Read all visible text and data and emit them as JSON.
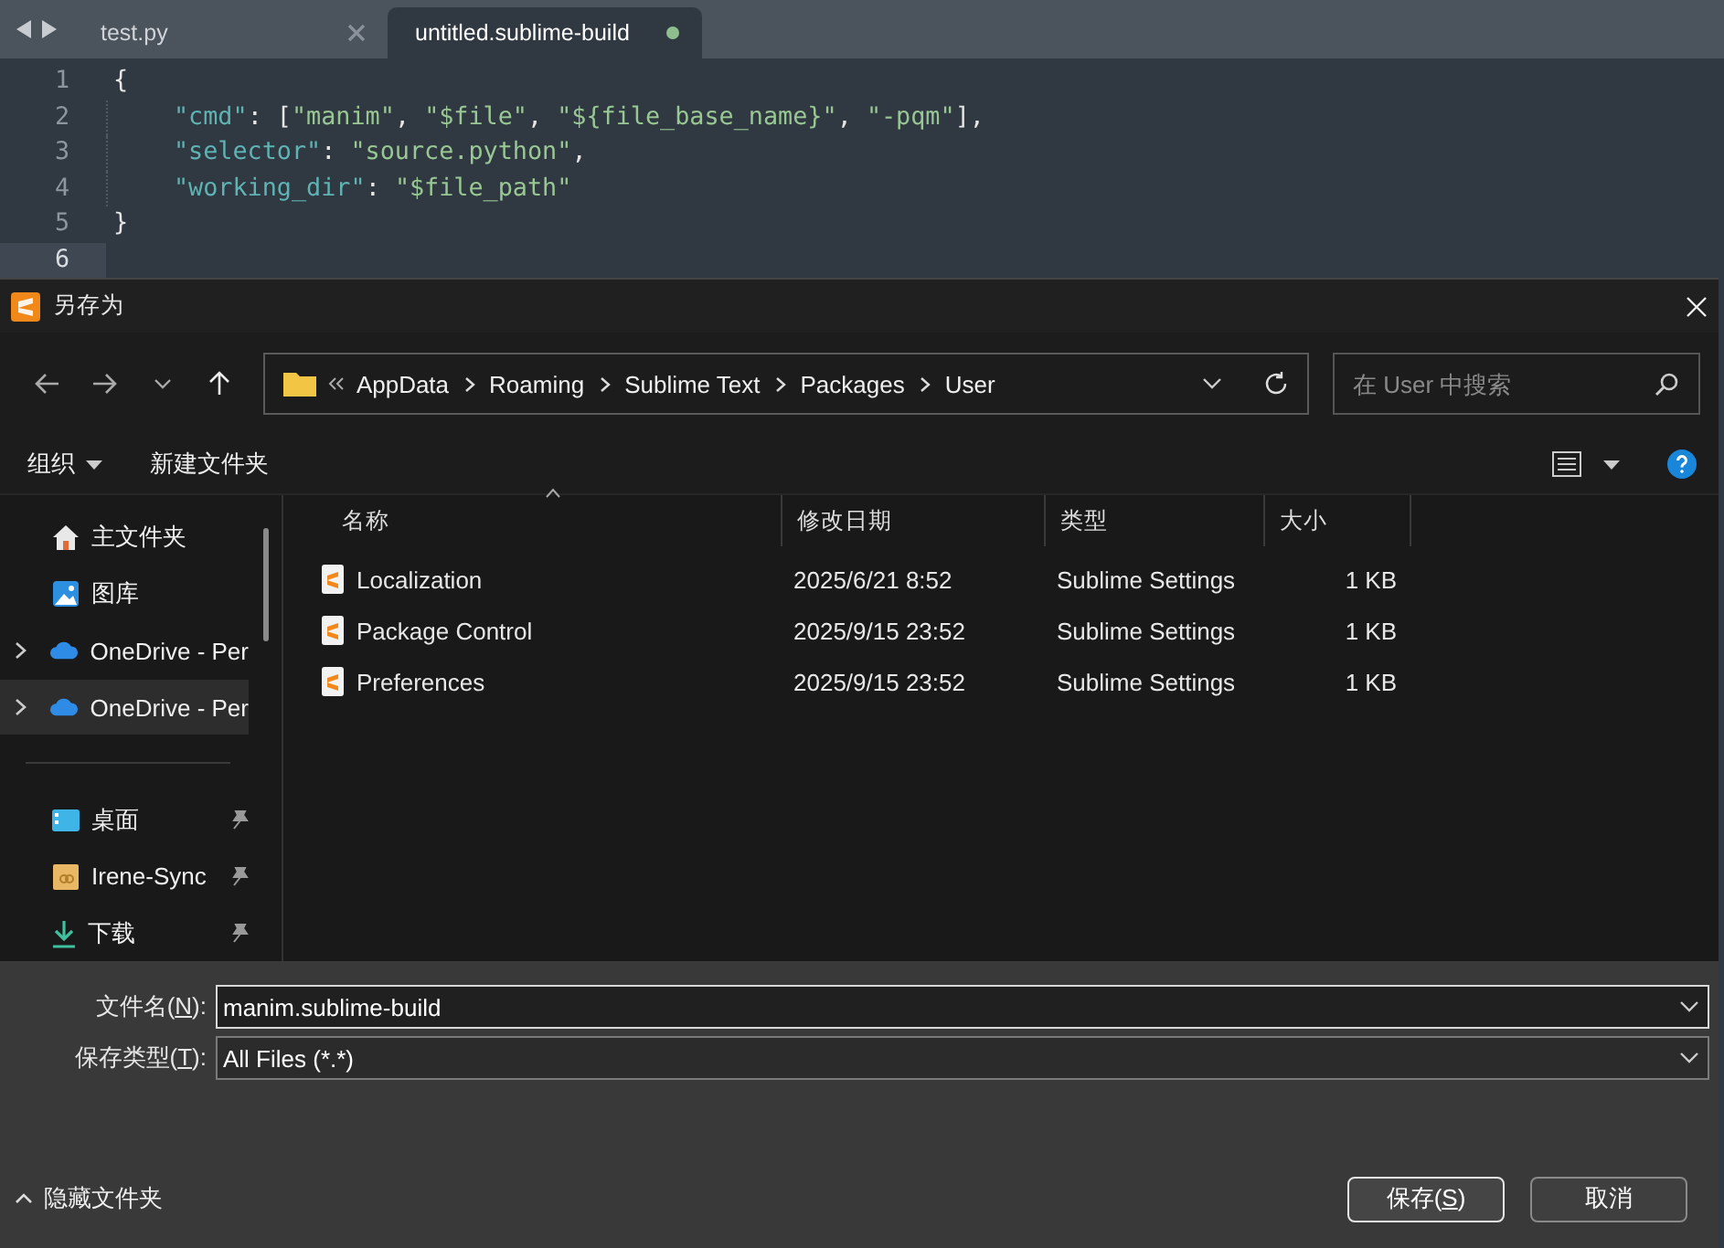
{
  "editor": {
    "tabs": [
      {
        "label": "test.py",
        "selected": false,
        "modified": false
      },
      {
        "label": "untitled.sublime-build",
        "selected": true,
        "modified": true
      }
    ],
    "lines": [
      {
        "number": "1",
        "indented": false,
        "current": false,
        "tokens": [
          {
            "kind": "punct",
            "text": "{"
          }
        ]
      },
      {
        "number": "2",
        "indented": true,
        "current": false,
        "tokens": [
          {
            "kind": "key",
            "text": "\"cmd\""
          },
          {
            "kind": "punct",
            "text": ": ["
          },
          {
            "kind": "string",
            "text": "\"manim\""
          },
          {
            "kind": "punct",
            "text": ", "
          },
          {
            "kind": "string",
            "text": "\"$file\""
          },
          {
            "kind": "punct",
            "text": ", "
          },
          {
            "kind": "string",
            "text": "\"${file_base_name}\""
          },
          {
            "kind": "punct",
            "text": ", "
          },
          {
            "kind": "string",
            "text": "\"-pqm\""
          },
          {
            "kind": "punct",
            "text": "],"
          }
        ]
      },
      {
        "number": "3",
        "indented": true,
        "current": false,
        "tokens": [
          {
            "kind": "key",
            "text": "\"selector\""
          },
          {
            "kind": "punct",
            "text": ": "
          },
          {
            "kind": "string",
            "text": "\"source.python\""
          },
          {
            "kind": "punct",
            "text": ","
          }
        ]
      },
      {
        "number": "4",
        "indented": true,
        "current": false,
        "tokens": [
          {
            "kind": "key",
            "text": "\"working_dir\""
          },
          {
            "kind": "punct",
            "text": ": "
          },
          {
            "kind": "string",
            "text": "\"$file_path\""
          }
        ]
      },
      {
        "number": "5",
        "indented": false,
        "current": false,
        "tokens": [
          {
            "kind": "punct",
            "text": "}"
          }
        ]
      },
      {
        "number": "6",
        "indented": false,
        "current": true
      }
    ]
  },
  "dialog": {
    "title": "另存为",
    "path": [
      "AppData",
      "Roaming",
      "Sublime Text",
      "Packages",
      "User"
    ],
    "search": {
      "placeholder": "在 User 中搜索"
    },
    "toolbar": {
      "organize": "组织",
      "new_folder": "新建文件夹"
    },
    "sidebar": {
      "items": [
        {
          "kind": "home",
          "label": "主文件夹",
          "expandable": false,
          "selected": false,
          "pinned": false
        },
        {
          "kind": "gallery",
          "label": "图库",
          "expandable": false,
          "selected": false,
          "pinned": false
        },
        {
          "kind": "cloud",
          "label": "OneDrive - Per",
          "expandable": true,
          "selected": false,
          "pinned": false
        },
        {
          "kind": "cloud",
          "label": "OneDrive - Per",
          "expandable": true,
          "selected": true,
          "pinned": false
        },
        {
          "kind": "divider"
        },
        {
          "kind": "desktop",
          "label": "桌面",
          "expandable": false,
          "selected": false,
          "pinned": true
        },
        {
          "kind": "folder",
          "label": "Irene-Sync",
          "expandable": false,
          "selected": false,
          "pinned": true
        },
        {
          "kind": "download",
          "label": "下载",
          "expandable": false,
          "selected": false,
          "pinned": true
        }
      ]
    },
    "columns": [
      {
        "label": "名称",
        "sorted": true
      },
      {
        "label": "修改日期",
        "sorted": false
      },
      {
        "label": "类型",
        "sorted": false
      },
      {
        "label": "大小",
        "sorted": false
      }
    ],
    "files": [
      {
        "name": "Localization",
        "modified": "2025/6/21 8:52",
        "type": "Sublime Settings",
        "size": "1 KB"
      },
      {
        "name": "Package Control",
        "modified": "2025/9/15 23:52",
        "type": "Sublime Settings",
        "size": "1 KB"
      },
      {
        "name": "Preferences",
        "modified": "2025/9/15 23:52",
        "type": "Sublime Settings",
        "size": "1 KB"
      }
    ],
    "filename": {
      "label": "文件名(",
      "access_key": "N",
      "label_end": "):",
      "value": "manim.sublime-build",
      "focused": true
    },
    "filetype": {
      "label": "保存类型(",
      "access_key": "T",
      "label_end": "):",
      "value": "All Files (*.*)",
      "focused": false
    },
    "hide_folders": "隐藏文件夹",
    "buttons": [
      {
        "kind": "primary",
        "label": "保存(",
        "access_key": "S",
        "label_end": ")"
      },
      {
        "kind": "secondary",
        "label": "取消"
      }
    ]
  }
}
